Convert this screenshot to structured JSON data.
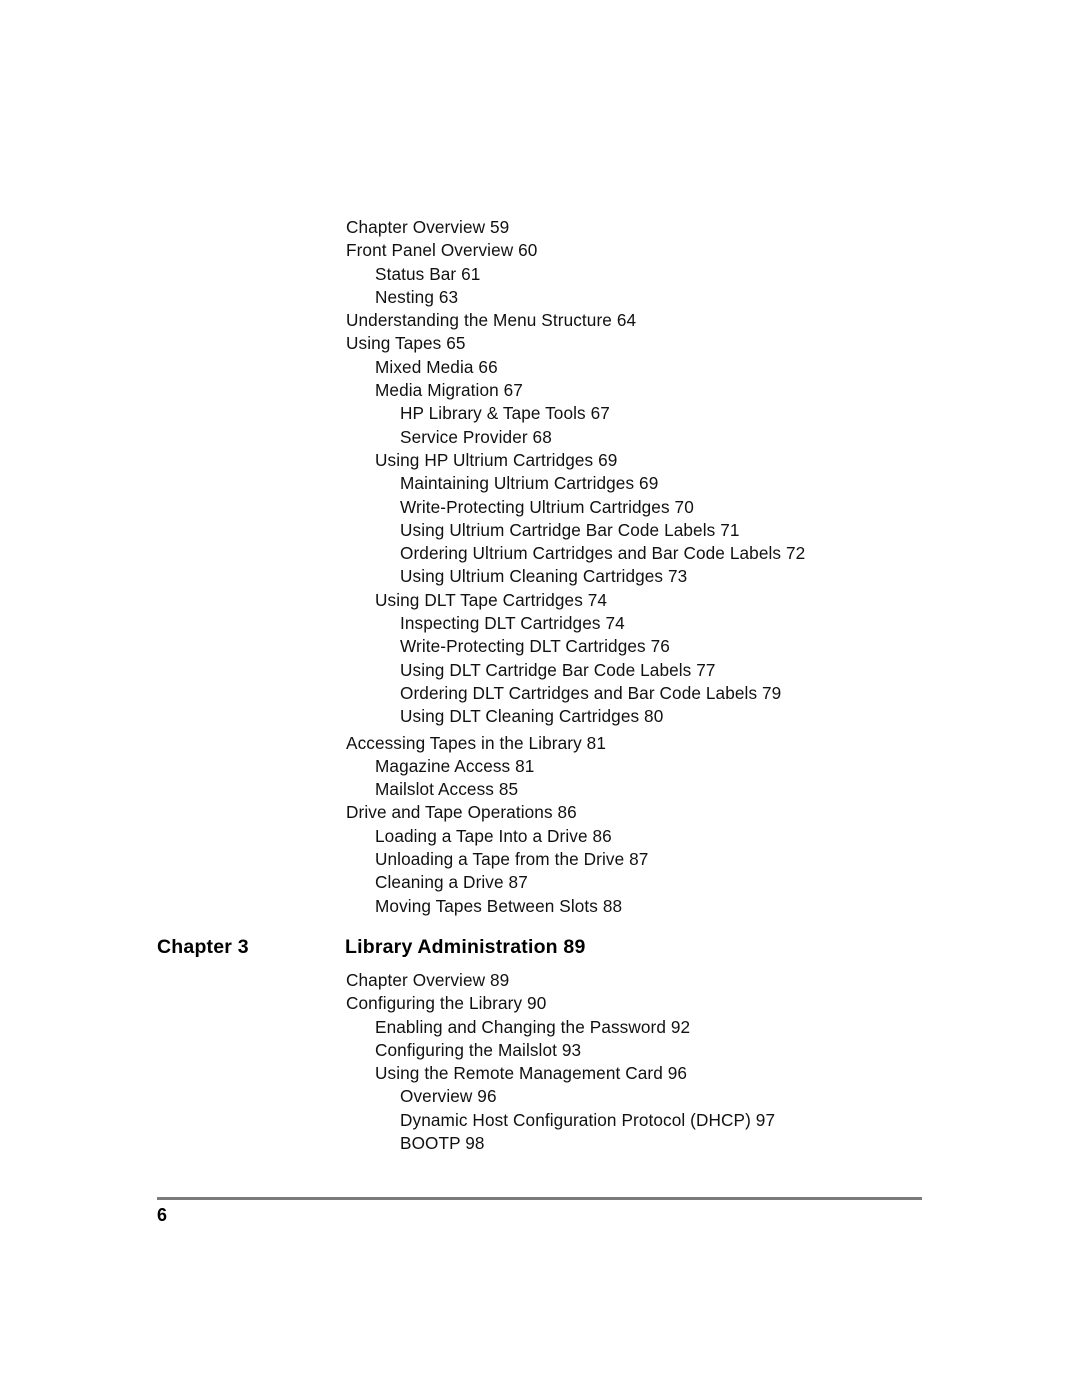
{
  "document": {
    "type": "table-of-contents",
    "page_number": "6",
    "text_color": "#111111",
    "rule_color": "#7b7b7b",
    "background_color": "#ffffff"
  },
  "toc_upper": [
    {
      "level": 1,
      "text": "Chapter Overview 59"
    },
    {
      "level": 1,
      "text": "Front Panel Overview 60"
    },
    {
      "level": 2,
      "text": "Status Bar 61"
    },
    {
      "level": 2,
      "text": "Nesting 63"
    },
    {
      "level": 1,
      "text": "Understanding the Menu Structure 64"
    },
    {
      "level": 1,
      "text": "Using Tapes 65"
    },
    {
      "level": 2,
      "text": "Mixed Media 66"
    },
    {
      "level": 2,
      "text": "Media Migration 67"
    },
    {
      "level": 3,
      "text": "HP Library & Tape Tools 67"
    },
    {
      "level": 3,
      "text": "Service Provider 68"
    },
    {
      "level": 2,
      "text": "Using HP Ultrium Cartridges 69"
    },
    {
      "level": 3,
      "text": "Maintaining Ultrium Cartridges 69"
    },
    {
      "level": 3,
      "text": "Write-Protecting Ultrium Cartridges 70"
    },
    {
      "level": 3,
      "text": "Using Ultrium Cartridge Bar Code Labels 71"
    },
    {
      "level": 3,
      "text": "Ordering Ultrium Cartridges and Bar Code Labels 72"
    },
    {
      "level": 3,
      "text": "Using Ultrium Cleaning Cartridges 73"
    },
    {
      "level": 2,
      "text": "Using DLT Tape Cartridges 74"
    },
    {
      "level": 3,
      "text": "Inspecting DLT Cartridges 74"
    },
    {
      "level": 3,
      "text": "Write-Protecting DLT Cartridges 76"
    },
    {
      "level": 3,
      "text": "Using DLT Cartridge Bar Code Labels 77"
    },
    {
      "level": 3,
      "text": "Ordering DLT Cartridges and Bar Code Labels 79"
    },
    {
      "level": 3,
      "text": "Using DLT Cleaning Cartridges 80"
    },
    {
      "level": 1,
      "text": "Accessing Tapes in the Library 81",
      "gap_before": true
    },
    {
      "level": 2,
      "text": "Magazine Access 81"
    },
    {
      "level": 2,
      "text": "Mailslot Access 85"
    },
    {
      "level": 1,
      "text": "Drive and Tape Operations 86"
    },
    {
      "level": 2,
      "text": "Loading a Tape Into a Drive 86"
    },
    {
      "level": 2,
      "text": "Unloading a Tape from the Drive 87"
    },
    {
      "level": 2,
      "text": "Cleaning a Drive 87"
    },
    {
      "level": 2,
      "text": "Moving Tapes Between Slots 88"
    }
  ],
  "chapter_heading": {
    "label": "Chapter 3",
    "title": "Library Administration 89"
  },
  "toc_lower": [
    {
      "level": 1,
      "text": "Chapter Overview 89"
    },
    {
      "level": 1,
      "text": "Configuring the Library 90"
    },
    {
      "level": 2,
      "text": "Enabling and Changing the Password 92"
    },
    {
      "level": 2,
      "text": "Configuring the Mailslot 93"
    },
    {
      "level": 2,
      "text": "Using the Remote Management Card 96"
    },
    {
      "level": 3,
      "text": "Overview 96"
    },
    {
      "level": 3,
      "text": "Dynamic Host Configuration Protocol (DHCP) 97"
    },
    {
      "level": 3,
      "text": "BOOTP 98"
    }
  ]
}
